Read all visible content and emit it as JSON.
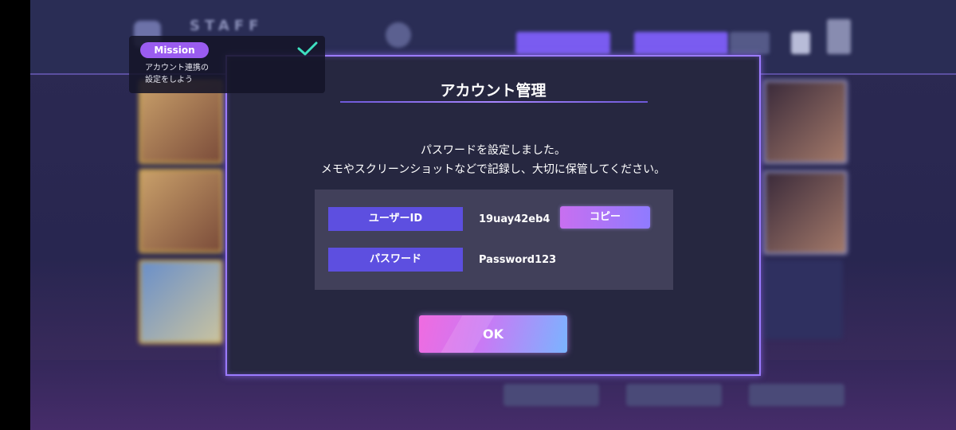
{
  "mission": {
    "tag": "Mission",
    "text_line1": "アカウント連携の",
    "text_line2": "設定をしよう",
    "completed": true
  },
  "background": {
    "header_title": "STAFF"
  },
  "modal": {
    "title": "アカウント管理",
    "message_line1": "パスワードを設定しました。",
    "message_line2": "メモやスクリーンショットなどで記録し、大切に保管してください。",
    "user_id_label": "ユーザーID",
    "user_id_value": "19uay42eb4",
    "copy_label": "コピー",
    "password_label": "パスワード",
    "password_value": "Password123",
    "ok_label": "OK"
  },
  "colors": {
    "accent": "#9b7bff",
    "label_button": "#5d4fe0",
    "mission_tag": "#9a5cf0",
    "check": "#3ee0c0"
  },
  "icons": [
    "check-icon"
  ]
}
